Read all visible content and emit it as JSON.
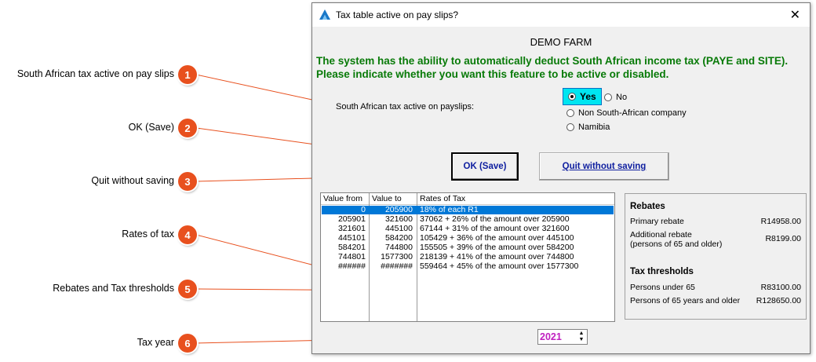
{
  "callouts": [
    {
      "number": "1",
      "label": "South African tax active on pay slips"
    },
    {
      "number": "2",
      "label": "OK (Save)"
    },
    {
      "number": "3",
      "label": "Quit without saving"
    },
    {
      "number": "4",
      "label": "Rates of tax"
    },
    {
      "number": "5",
      "label": "Rebates and Tax thresholds"
    },
    {
      "number": "6",
      "label": "Tax year"
    }
  ],
  "window": {
    "title": "Tax table active on pay slips?",
    "close_symbol": "✕",
    "company": "DEMO FARM",
    "intro": "The system has the ability to automatically deduct South African income tax (PAYE and SITE). Please indicate whether you want this feature to be active or disabled.",
    "field_label": "South African tax active on payslips:",
    "options": {
      "yes": "Yes",
      "no": "No",
      "non_sa": "Non South-African company",
      "namibia": "Namibia"
    },
    "ok_label": "OK (Save)",
    "quit_label": "Quit without saving"
  },
  "tax_table": {
    "headers": [
      "Value from",
      "Value to",
      "Rates of Tax"
    ],
    "rows": [
      [
        "0",
        "205900",
        "18% of each R1"
      ],
      [
        "205901",
        "321600",
        "37062 + 26% of the amount over 205900"
      ],
      [
        "321601",
        "445100",
        "67144 + 31% of the amount over 321600"
      ],
      [
        "445101",
        "584200",
        "105429 + 36% of the amount over 445100"
      ],
      [
        "584201",
        "744800",
        "155505 + 39% of the amount over 584200"
      ],
      [
        "744801",
        "1577300",
        "218139 + 41% of the amount over 744800"
      ],
      [
        "######",
        "#######",
        "559464 + 45% of the amount over 1577300"
      ]
    ]
  },
  "rebates": {
    "title": "Rebates",
    "primary_label": "Primary rebate",
    "primary_value": "R14958.00",
    "additional_label_1": "Additional rebate",
    "additional_label_2": "(persons of 65 and older)",
    "additional_value": "R8199.00",
    "thresholds_title": "Tax thresholds",
    "under65_label": "Persons under 65",
    "under65_value": "R83100.00",
    "over65_label": "Persons of 65 years and older",
    "over65_value": "R128650.00"
  },
  "tax_year": "2021",
  "colors": {
    "accent": "#e8501e",
    "intro": "#087a08",
    "selected": "#0078d7",
    "year": "#c020c0"
  }
}
